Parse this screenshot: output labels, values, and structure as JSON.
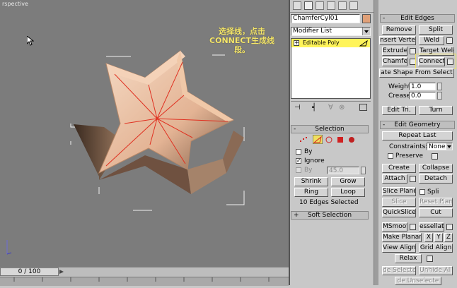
{
  "viewport": {
    "label": "rspective",
    "annotation_line1": "选择线，点击",
    "annotation_line2": "CONNECT生成线",
    "annotation_line3": "段。"
  },
  "timeline": {
    "position": "0 / 100"
  },
  "modifier": {
    "object_name": "ChamferCyl01",
    "color": "#e0a078",
    "list_label": "Modifier List",
    "stack_item": "Editable Poly"
  },
  "selection": {
    "title": "Selection",
    "by_vertex": "By",
    "ignore_backfacing": "Ignore",
    "by_angle": "By",
    "angle_value": "45.0",
    "shrink": "Shrink",
    "grow": "Grow",
    "ring": "Ring",
    "loop": "Loop",
    "status": "10 Edges Selected"
  },
  "soft_selection": {
    "title": "Soft Selection"
  },
  "edit_edges": {
    "title": "Edit Edges",
    "remove": "Remove",
    "split": "Split",
    "insert_vertex": "nsert Verte",
    "weld": "Weld",
    "extrude": "Extrude",
    "target_weld": "Target Weld",
    "chamfer": "Chamfer",
    "connect": "Connect",
    "create_shape": "ate Shape From Select",
    "weight_label": "Weight:",
    "weight_value": "1.0",
    "crease_label": "Crease:",
    "crease_value": "0.0",
    "edit_tri": "Edit Tri.",
    "turn": "Turn"
  },
  "edit_geometry": {
    "title": "Edit Geometry",
    "repeat_last": "Repeat Last",
    "constraints_label": "Constraints:",
    "constraints_value": "None",
    "preserve_uvs": "Preserve",
    "create": "Create",
    "collapse": "Collapse",
    "attach": "Attach",
    "detach": "Detach",
    "slice_plane": "Slice Plane",
    "split": "Spli",
    "slice": "Slice",
    "reset_plane": "Reset Plan",
    "quickslice": "QuickSlice",
    "cut": "Cut",
    "msmooth": "MSmooth",
    "tessellate": "essellat",
    "make_planar": "Make Planar",
    "x": "X",
    "y": "Y",
    "z": "Z",
    "view_align": "View Align",
    "grid_align": "Grid Align",
    "relax": "Relax",
    "hide_selected": "de Selecte",
    "unhide_all": "Unhide All",
    "hide_unselected": "de Unselecte"
  }
}
